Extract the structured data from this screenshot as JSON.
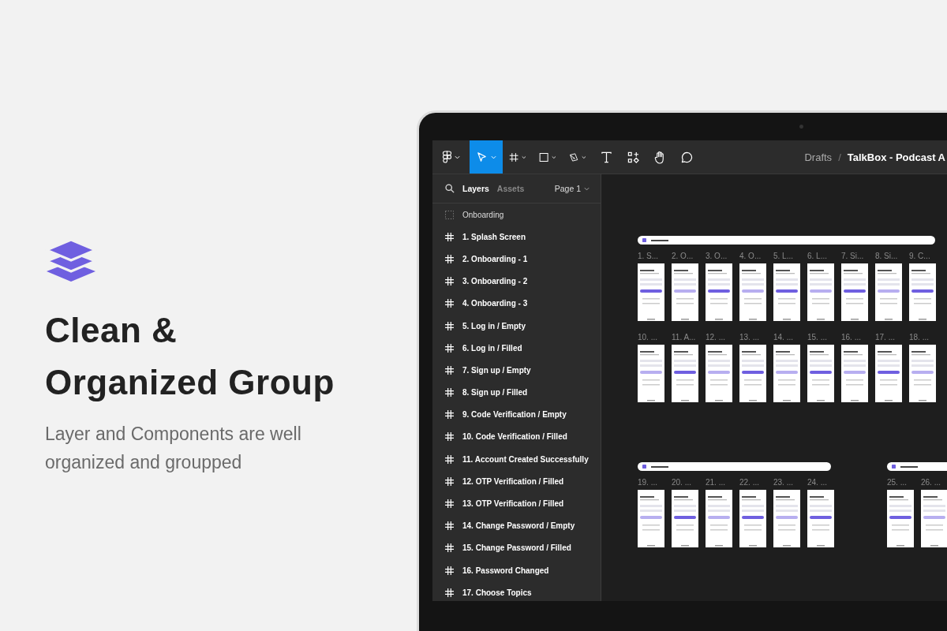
{
  "promo": {
    "heading": "Clean & Organized Group",
    "text": "Layer and Components are well organized and groupped"
  },
  "toolbar": {
    "tools": [
      {
        "kind": "logo",
        "selected": false,
        "menu": true
      },
      {
        "kind": "move",
        "selected": true,
        "menu": true
      },
      {
        "kind": "frame",
        "selected": false,
        "menu": true
      },
      {
        "kind": "rect",
        "selected": false,
        "menu": true
      },
      {
        "kind": "pen",
        "selected": false,
        "menu": true
      },
      {
        "kind": "text",
        "selected": false,
        "menu": false
      },
      {
        "kind": "resources",
        "selected": false,
        "menu": false
      },
      {
        "kind": "hand",
        "selected": false,
        "menu": false
      },
      {
        "kind": "comment",
        "selected": false,
        "menu": false
      }
    ],
    "breadcrumb": {
      "folder": "Drafts",
      "separator": "/",
      "file": "TalkBox - Podcast A"
    }
  },
  "sidebar": {
    "tabs": [
      {
        "label": "Layers",
        "selected": true
      },
      {
        "label": "Assets",
        "selected": false
      }
    ],
    "page": "Page 1",
    "layers": [
      {
        "kind": "section",
        "name": "Onboarding"
      },
      {
        "kind": "frame",
        "name": "1. Splash Screen"
      },
      {
        "kind": "frame",
        "name": "2. Onboarding - 1"
      },
      {
        "kind": "frame",
        "name": "3. Onboarding - 2"
      },
      {
        "kind": "frame",
        "name": "4. Onboarding - 3"
      },
      {
        "kind": "frame",
        "name": "5. Log in / Empty"
      },
      {
        "kind": "frame",
        "name": "6. Log in / Filled"
      },
      {
        "kind": "frame",
        "name": "7. Sign up / Empty"
      },
      {
        "kind": "frame",
        "name": "8. Sign up / Filled"
      },
      {
        "kind": "frame",
        "name": "9. Code Verification / Empty"
      },
      {
        "kind": "frame",
        "name": "10. Code Verification / Filled"
      },
      {
        "kind": "frame",
        "name": "11. Account Created Successfully"
      },
      {
        "kind": "frame",
        "name": "12. OTP Verification / Filled"
      },
      {
        "kind": "frame",
        "name": "13. OTP Verification / Filled"
      },
      {
        "kind": "frame",
        "name": "14. Change Password / Empty"
      },
      {
        "kind": "frame",
        "name": "15. Change Password / Filled"
      },
      {
        "kind": "frame",
        "name": "16. Password Changed"
      },
      {
        "kind": "frame",
        "name": "17. Choose Topics"
      }
    ]
  },
  "canvas": {
    "sections": [
      {
        "rows": [
          [
            "1. S...",
            "2. O...",
            "3. O...",
            "4. O...",
            "5. L...",
            "6. L...",
            "7. Si...",
            "8. Si...",
            "9. C..."
          ],
          [
            "10. ...",
            "11. A...",
            "12. ...",
            "13. ...",
            "14. ...",
            "15. ...",
            "16. ...",
            "17. ...",
            "18. ..."
          ]
        ]
      },
      {
        "rows": [
          [
            "19. ...",
            "20. ...",
            "21. ...",
            "22. ...",
            "23. ...",
            "24. ..."
          ]
        ]
      },
      {
        "rows": [
          [
            "25. ...",
            "26. ..."
          ]
        ]
      }
    ]
  }
}
